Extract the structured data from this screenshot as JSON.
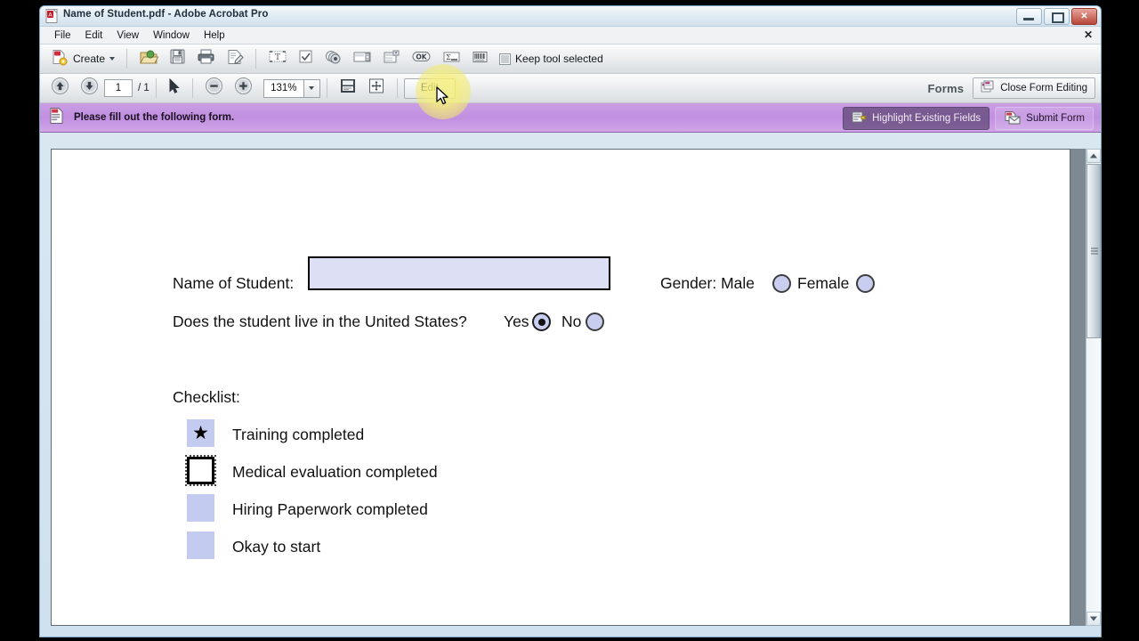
{
  "window": {
    "title": "Name of Student.pdf - Adobe Acrobat Pro",
    "minimize_label": "Minimize",
    "maximize_label": "Maximize",
    "close_label": "✕",
    "menu_close_label": "✕"
  },
  "menu": {
    "items": [
      {
        "label": "File"
      },
      {
        "label": "Edit"
      },
      {
        "label": "View"
      },
      {
        "label": "Window"
      },
      {
        "label": "Help"
      }
    ]
  },
  "toolbar_main": {
    "create_label": "Create",
    "keep_tool_label": "Keep tool selected",
    "tools": [
      {
        "name": "open-file-icon",
        "title": "Open"
      },
      {
        "name": "save-icon",
        "title": "Save"
      },
      {
        "name": "print-icon",
        "title": "Print"
      },
      {
        "name": "edit-document-icon",
        "title": "Edit Document Text"
      }
    ],
    "form_tools": [
      {
        "name": "text-field-tool-icon",
        "title": "Text Field"
      },
      {
        "name": "check-box-tool-icon",
        "title": "Check Box"
      },
      {
        "name": "radio-button-tool-icon",
        "title": "Radio Button"
      },
      {
        "name": "list-box-tool-icon",
        "title": "List Box"
      },
      {
        "name": "dropdown-tool-icon",
        "title": "Dropdown"
      },
      {
        "name": "button-tool-icon",
        "title": "Button",
        "glyph": "OK"
      },
      {
        "name": "signature-field-tool-icon",
        "title": "Digital Signature"
      },
      {
        "name": "barcode-tool-icon",
        "title": "Barcode"
      }
    ]
  },
  "toolbar_nav": {
    "page_current": "1",
    "page_total": "/ 1",
    "zoom_level": "131%",
    "edit_label": "Edit",
    "forms_label": "Forms",
    "close_form_editing_label": "Close Form Editing"
  },
  "notice": {
    "message": "Please fill out the following form.",
    "highlight_label": "Highlight Existing Fields",
    "submit_label": "Submit Form"
  },
  "form": {
    "name_label": "Name of Student:",
    "name_value": "",
    "gender_label": "Gender: Male",
    "gender_female_label": "Female",
    "residency_question": "Does the student live in the United States?",
    "yes_label": "Yes",
    "no_label": "No",
    "checklist_title": "Checklist:",
    "checklist": [
      {
        "label": "Training completed",
        "state": "checked-star",
        "glyph": "★"
      },
      {
        "label": "Medical evaluation completed",
        "state": "selected-empty"
      },
      {
        "label": "Hiring Paperwork completed",
        "state": "unchecked"
      },
      {
        "label": "Okay to start",
        "state": "unchecked"
      }
    ]
  },
  "colors": {
    "notice_bar": "#c08fe0",
    "field_fill": "#dde0f5",
    "checkbox_fill": "#c3cbf0",
    "highlight_halo": "#f5ee78"
  }
}
